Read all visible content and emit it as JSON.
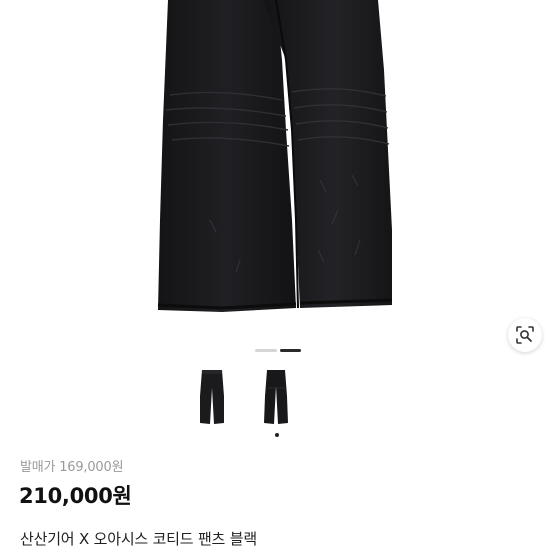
{
  "product": {
    "release_price_label": "발매가",
    "release_price": "169,000원",
    "sale_price": "210,000원",
    "title": "산산기어 X 오아시스 코티드 팬츠 블랙"
  },
  "gallery": {
    "image_count": 2,
    "current_index": 2,
    "thumbnails": [
      "pants-front-thumbnail",
      "pants-back-thumbnail"
    ],
    "main_image": "black-coated-pants",
    "lens_icon": "search-image-icon"
  }
}
